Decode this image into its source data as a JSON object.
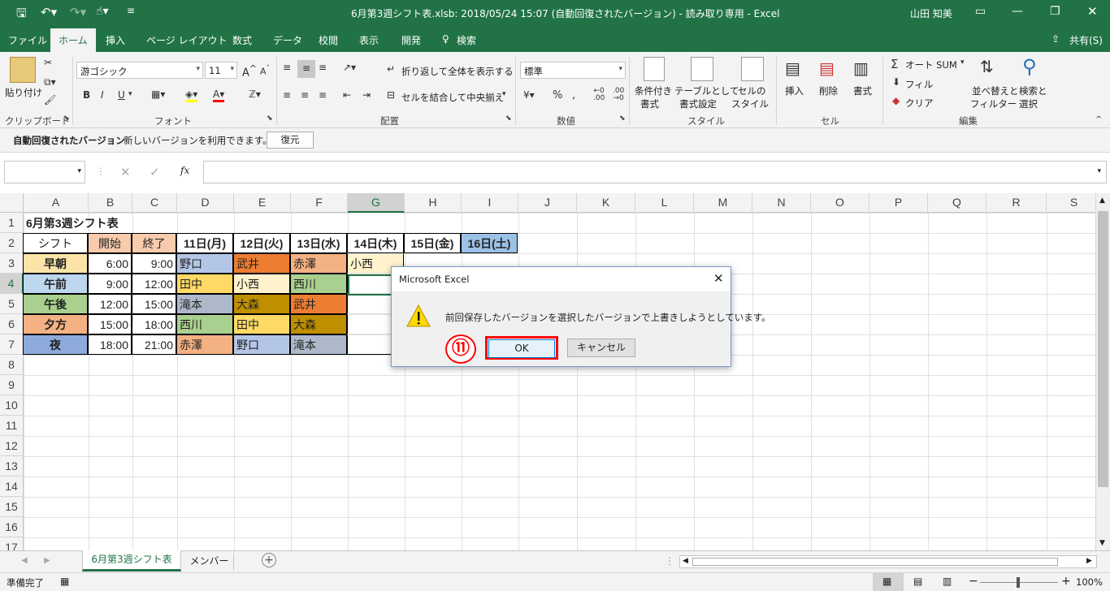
{
  "title_bar": {
    "doc_title": "6月第3週シフト表.xlsb: 2018/05/24 15:07 (自動回復されたバージョン) - 読み取り専用 - Excel",
    "user": "山田 知美"
  },
  "tabs": [
    "ファイル",
    "ホーム",
    "挿入",
    "ページ レイアウト",
    "数式",
    "データ",
    "校閲",
    "表示",
    "開発"
  ],
  "active_tab": "ホーム",
  "search_label": "検索",
  "share_label": "共有(S)",
  "ribbon": {
    "clipboard": {
      "paste": "貼り付け",
      "group": "クリップボード"
    },
    "font": {
      "name": "游ゴシック",
      "size": "11",
      "bold": "B",
      "italic": "I",
      "underline": "U",
      "group": "フォント"
    },
    "alignment": {
      "wrap": "折り返して全体を表示する",
      "merge": "セルを結合して中央揃え",
      "group": "配置"
    },
    "number": {
      "format": "標準",
      "percent": "%",
      "group": "数値"
    },
    "styles": {
      "conditional": "条件付き",
      "conditional2": "書式",
      "table": "テーブルとして",
      "table2": "書式設定",
      "cellstyle": "セルの",
      "cellstyle2": "スタイル",
      "group": "スタイル"
    },
    "cells": {
      "insert": "挿入",
      "delete": "削除",
      "format": "書式",
      "group": "セル"
    },
    "editing": {
      "autosum": "オート SUM",
      "fill": "フィル",
      "clear": "クリア",
      "sort": "並べ替えと",
      "sort2": "フィルター",
      "find": "検索と",
      "find2": "選択",
      "group": "編集"
    }
  },
  "info_bar": {
    "title": "自動回復されたバージョン",
    "message": "新しいバージョンを利用できます。",
    "button": "復元"
  },
  "formula_bar": {
    "name_box": "",
    "fx": "fx",
    "formula": ""
  },
  "columns": [
    "A",
    "B",
    "C",
    "D",
    "E",
    "F",
    "G",
    "H",
    "I",
    "J",
    "K",
    "L",
    "M",
    "N",
    "O",
    "P",
    "Q",
    "R",
    "S"
  ],
  "rows": [
    "1",
    "2",
    "3",
    "4",
    "5",
    "6",
    "7",
    "8",
    "9",
    "10",
    "11",
    "12",
    "13",
    "14",
    "15",
    "16",
    "17"
  ],
  "sheet": {
    "title": "6月第3週シフト表",
    "headers": [
      "シフト",
      "開始",
      "終了",
      "11日(月)",
      "12日(火)",
      "13日(水)",
      "14日(木)",
      "15日(金)",
      "16日(土)"
    ],
    "body": [
      {
        "shift": "早朝",
        "start": "6:00",
        "end": "9:00",
        "d11": "野口",
        "d12": "武井",
        "d13": "赤澤",
        "d14": "小西"
      },
      {
        "shift": "午前",
        "start": "9:00",
        "end": "12:00",
        "d11": "田中",
        "d12": "小西",
        "d13": "西川",
        "d14": ""
      },
      {
        "shift": "午後",
        "start": "12:00",
        "end": "15:00",
        "d11": "滝本",
        "d12": "大森",
        "d13": "武井",
        "d14": ""
      },
      {
        "shift": "夕方",
        "start": "15:00",
        "end": "18:00",
        "d11": "西川",
        "d12": "田中",
        "d13": "大森",
        "d14": ""
      },
      {
        "shift": "夜",
        "start": "18:00",
        "end": "21:00",
        "d11": "赤澤",
        "d12": "野口",
        "d13": "滝本",
        "d14": ""
      }
    ]
  },
  "colors": {
    "brand": "#217346",
    "early": "#fce4a8",
    "morning": "#bdd7ee",
    "afternoon": "#a9d08e",
    "evening": "#f4b183",
    "night": "#8eaadb",
    "start_hdr": "#f8cbad",
    "end_hdr": "#f8cbad",
    "sat_hdr": "#9bc2e6",
    "highlight": "#ff0000"
  },
  "sheet_tabs": [
    "6月第3週シフト表",
    "メンバー"
  ],
  "status": {
    "ready": "準備完了",
    "zoom": "100%"
  },
  "dialog": {
    "title": "Microsoft Excel",
    "message": "前回保存したバージョンを選択したバージョンで上書きしようとしています。",
    "ok": "OK",
    "cancel": "キャンセル",
    "step": "⑪"
  }
}
